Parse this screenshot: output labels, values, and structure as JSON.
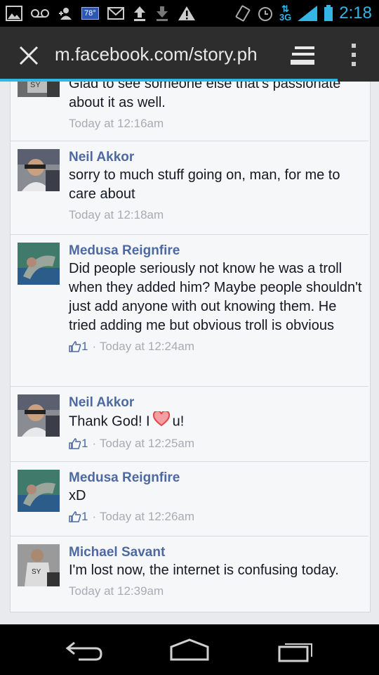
{
  "status_bar": {
    "temperature": "78°",
    "network": "3G",
    "time": "2:18",
    "icons": [
      "gallery-icon",
      "voicemail-icon",
      "add-person-icon",
      "weather-icon",
      "gmail-icon",
      "upload-icon",
      "download-icon",
      "warning-icon",
      "vibrate-icon",
      "alarm-icon",
      "network-3g-icon",
      "signal-icon",
      "battery-icon"
    ]
  },
  "url_bar": {
    "url": "m.facebook.com/story.ph",
    "load_progress": 0.89
  },
  "comments": [
    {
      "name": "",
      "text": "Glad to see someone else that's passionate about it as well.",
      "time": "Today at 12:16am",
      "likes": ""
    },
    {
      "name": "Neil Akkor",
      "text": "sorry to much stuff going on, man, for me to care about",
      "time": "Today at 12:18am",
      "likes": ""
    },
    {
      "name": "Medusa Reignfire",
      "text": "Did people seriously not know he was a troll when they added him? Maybe people shouldn't just add anyone with out knowing them. He tried adding me but obvious troll is obvious",
      "time": "Today at 12:24am",
      "likes": "1"
    },
    {
      "name": "Neil Akkor",
      "text_before": "Thank God! I",
      "text_after": "u!",
      "time": "Today at 12:25am",
      "likes": "1"
    },
    {
      "name": "Medusa Reignfire",
      "text": "xD",
      "time": "Today at 12:26am",
      "likes": "1"
    },
    {
      "name": "Michael Savant",
      "text": "I'm lost now, the internet is confusing today.",
      "time": "Today at 12:39am",
      "likes": ""
    }
  ],
  "meta_separator": "·",
  "colors": {
    "accent": "#33b5e5",
    "name": "#4e69a2",
    "meta": "#a7abb3",
    "heart": "#e0474c"
  },
  "nav_bar": {
    "icons": [
      "back-icon",
      "home-icon",
      "recent-apps-icon"
    ]
  }
}
